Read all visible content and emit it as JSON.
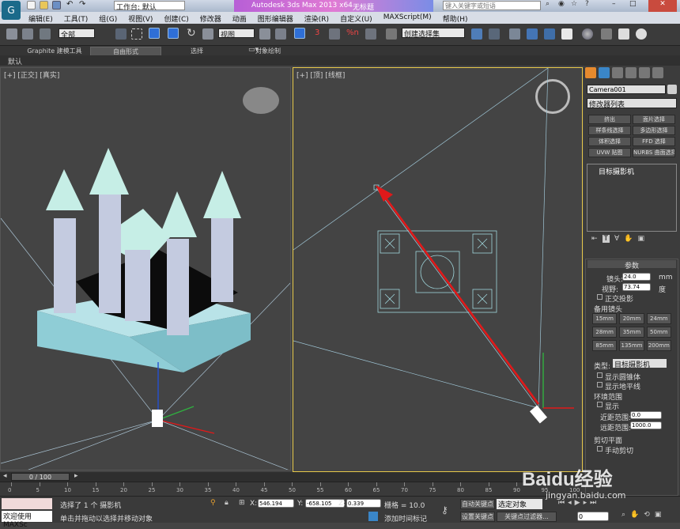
{
  "title": {
    "workspace_label": "工作台: 默认",
    "app_name": "Autodesk 3ds Max  2013 x64",
    "file_name": "无标题",
    "search_placeholder": "键入关键字或短语"
  },
  "menu": [
    "编辑(E)",
    "工具(T)",
    "组(G)",
    "视图(V)",
    "创建(C)",
    "修改器",
    "动画",
    "图形编辑器",
    "渲染(R)",
    "自定义(U)",
    "MAXScript(M)",
    "帮助(H)"
  ],
  "toolbar": {
    "selection_filter": "全部",
    "ref_coord": "视图",
    "named_selection": "创建选择集",
    "snap_value": "3",
    "angle_value": "%n"
  },
  "ribbon": {
    "tabs": [
      "Graphite 建模工具",
      "自由形式",
      "选择",
      "对象绘制"
    ],
    "active_tab": "自由形式",
    "sub": "默认"
  },
  "viewport_left": {
    "label": "[+] [正交] [真实]"
  },
  "viewport_right": {
    "label": "[+] [顶] [线框]"
  },
  "command_panel": {
    "object_name": "Camera001",
    "modifier_list": "修改器列表",
    "mod_buttons": [
      [
        "挤出",
        "面片选择"
      ],
      [
        "样条线选择",
        "多边形选择"
      ],
      [
        "体积选择",
        "FFD 选择"
      ],
      [
        "UVW 贴图",
        "NURBS 曲面选择"
      ]
    ],
    "stack_item": "目标摄影机",
    "rollout_title": "参数",
    "lens_label": "镜头:",
    "lens_value": "24.0",
    "lens_unit": "mm",
    "fov_label": "视野:",
    "fov_value": "73.74",
    "fov_unit": "度",
    "ortho": "正交投影",
    "stock_lenses_label": "备用镜头",
    "stock_lenses": [
      "15mm",
      "20mm",
      "24mm",
      "28mm",
      "35mm",
      "50mm",
      "85mm",
      "135mm",
      "200mm"
    ],
    "type_label": "类型:",
    "type_value": "目标摄影机",
    "show_cone": "显示圆锥体",
    "show_horizon": "显示地平线",
    "env_range": "环境范围",
    "env_show": "显示",
    "near_range_label": "近距范围:",
    "near_range_value": "0.0",
    "far_range_label": "远距范围:",
    "far_range_value": "1000.0",
    "clip_planes": "剪切平面",
    "manual_clip": "手动剪切"
  },
  "timeline": {
    "frame_readout": "0 / 100",
    "ticks": [
      "0",
      "5",
      "10",
      "15",
      "20",
      "25",
      "30",
      "35",
      "40",
      "45",
      "50",
      "55",
      "60",
      "65",
      "70",
      "75",
      "80",
      "85",
      "90",
      "95",
      "100"
    ]
  },
  "status": {
    "welcome": "欢迎使用 MAXSc",
    "selected": "选择了 1 个 摄影机",
    "hint": "单击并拖动以选择并移动对象",
    "x_label": "X:",
    "x_value": "546.194",
    "y_label": "Y:",
    "y_value": "-658.105",
    "z_label": "Z:",
    "z_value": "0.339",
    "grid": "栅格 = 10.0",
    "add_time_tag": "添加时间标记",
    "auto_key": "自动关键点",
    "set_key": "设置关键点",
    "selected_obj": "选定对象",
    "key_filters": "关键点过滤器...",
    "frame_value": "0"
  },
  "watermark": {
    "brand": "Baidu经验",
    "url": "jingyan.baidu.com"
  },
  "colors": {
    "accent": "#e6c84a",
    "arrow": "#e0191a",
    "camera_line": "#9fc6d6",
    "object_cyan": "#9fd6dc"
  }
}
